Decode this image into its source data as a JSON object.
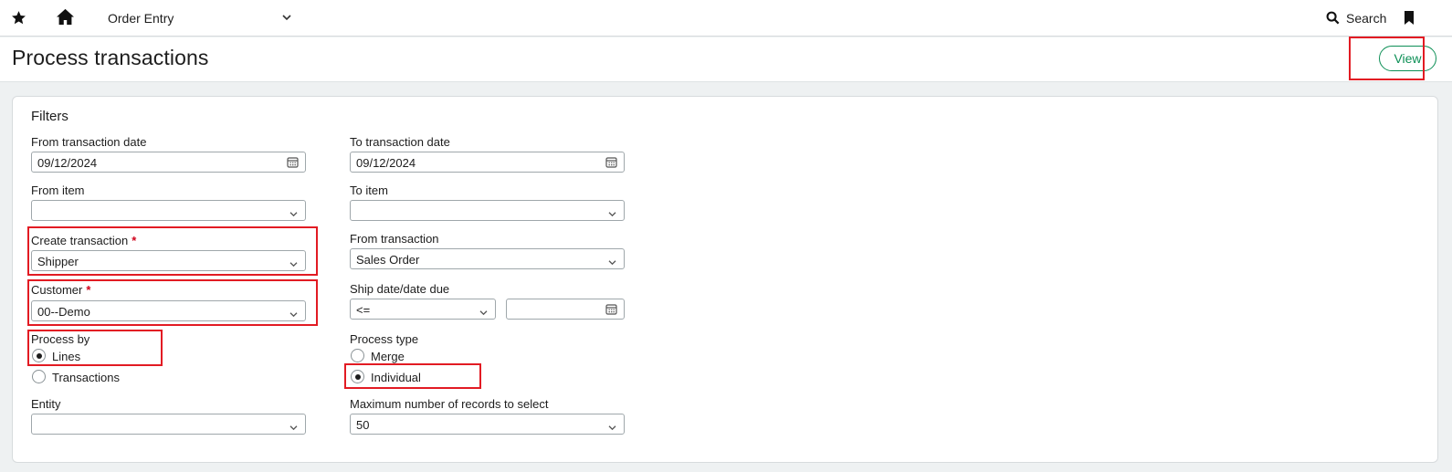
{
  "topbar": {
    "module": "Order Entry",
    "search_label": "Search",
    "icons": [
      "star-icon",
      "home-icon",
      "chevron-down-icon",
      "search-icon",
      "bookmark-icon"
    ]
  },
  "page": {
    "title": "Process transactions",
    "view_label": "View"
  },
  "filters": {
    "title": "Filters",
    "from_date": {
      "label": "From transaction date",
      "value": "09/12/2024"
    },
    "to_date": {
      "label": "To transaction date",
      "value": "09/12/2024"
    },
    "from_item": {
      "label": "From item",
      "value": ""
    },
    "to_item": {
      "label": "To item",
      "value": ""
    },
    "create_transaction": {
      "label": "Create transaction",
      "required": "*",
      "value": "Shipper"
    },
    "from_transaction": {
      "label": "From transaction",
      "value": "Sales Order"
    },
    "customer": {
      "label": "Customer",
      "required": "*",
      "value": "00--Demo"
    },
    "ship_date": {
      "label": "Ship date/date due",
      "operator": "<=",
      "value": ""
    },
    "process_by": {
      "label": "Process by",
      "options": [
        "Lines",
        "Transactions"
      ],
      "selected": "Lines"
    },
    "process_type": {
      "label": "Process type",
      "options": [
        "Merge",
        "Individual"
      ],
      "selected": "Individual"
    },
    "entity": {
      "label": "Entity",
      "value": ""
    },
    "max_records": {
      "label": "Maximum number of records to select",
      "value": "50"
    }
  },
  "colors": {
    "accent": "#0d8f56",
    "highlight": "#e21b23",
    "required": "#d0021b",
    "background": "#eef1f2"
  }
}
